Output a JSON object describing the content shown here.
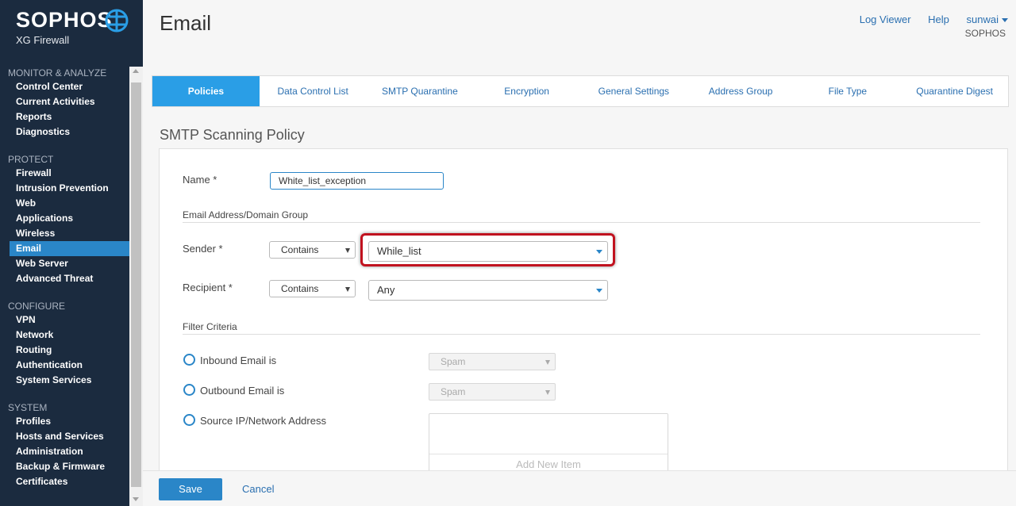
{
  "brand": {
    "name": "SOPHOS",
    "product": "XG Firewall"
  },
  "nav": {
    "monitor_title": "MONITOR & ANALYZE",
    "monitor_items": [
      "Control Center",
      "Current Activities",
      "Reports",
      "Diagnostics"
    ],
    "protect_title": "PROTECT",
    "protect_items": [
      "Firewall",
      "Intrusion Prevention",
      "Web",
      "Applications",
      "Wireless",
      "Email",
      "Web Server",
      "Advanced Threat"
    ],
    "configure_title": "CONFIGURE",
    "configure_items": [
      "VPN",
      "Network",
      "Routing",
      "Authentication",
      "System Services"
    ],
    "system_title": "SYSTEM",
    "system_items": [
      "Profiles",
      "Hosts and Services",
      "Administration",
      "Backup & Firmware",
      "Certificates"
    ],
    "active_item": "Email"
  },
  "header": {
    "title": "Email",
    "log_viewer": "Log Viewer",
    "help": "Help",
    "user": "sunwai",
    "org": "SOPHOS"
  },
  "tabs": [
    "Policies",
    "Data Control List",
    "SMTP Quarantine",
    "Encryption",
    "General Settings",
    "Address Group",
    "File Type",
    "Quarantine Digest"
  ],
  "active_tab": "Policies",
  "form": {
    "section_title": "SMTP Scanning Policy",
    "name_label": "Name *",
    "name_value": "White_list_exception",
    "address_group_title": "Email Address/Domain Group",
    "sender_label": "Sender *",
    "sender_match": "Contains",
    "sender_value": "While_list",
    "recipient_label": "Recipient *",
    "recipient_match": "Contains",
    "recipient_value": "Any",
    "filter_title": "Filter Criteria",
    "inbound_label": "Inbound Email is",
    "inbound_value": "Spam",
    "outbound_label": "Outbound Email is",
    "outbound_value": "Spam",
    "source_label": "Source IP/Network Address",
    "add_new_item": "Add New Item"
  },
  "footer": {
    "save": "Save",
    "cancel": "Cancel"
  },
  "colors": {
    "sidebar_bg": "#1b2b3f",
    "accent": "#2a86c8",
    "tab_active": "#2a9ee6",
    "highlight": "#c1121f"
  }
}
